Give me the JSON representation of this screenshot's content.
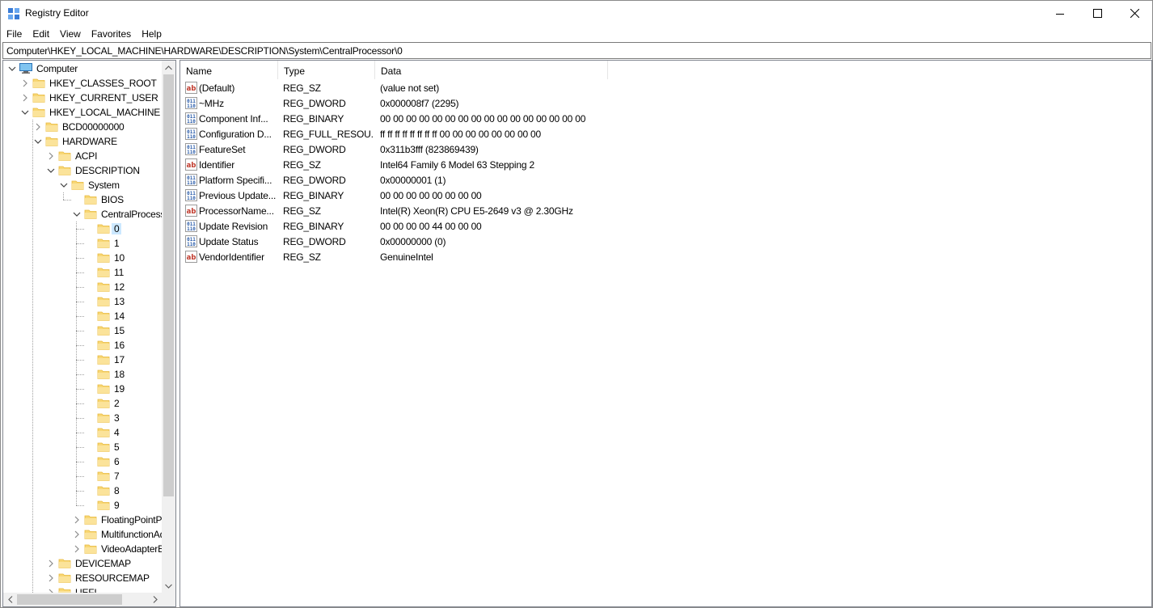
{
  "window": {
    "title": "Registry Editor"
  },
  "menu": [
    "File",
    "Edit",
    "View",
    "Favorites",
    "Help"
  ],
  "address": "Computer\\HKEY_LOCAL_MACHINE\\HARDWARE\\DESCRIPTION\\System\\CentralProcessor\\0",
  "tree": [
    {
      "label": "Computer",
      "level": 0,
      "expander": "expanded",
      "icon": "computer-icon"
    },
    {
      "label": "HKEY_CLASSES_ROOT",
      "level": 1,
      "expander": "collapsed",
      "icon": "folder-icon"
    },
    {
      "label": "HKEY_CURRENT_USER",
      "level": 1,
      "expander": "collapsed",
      "icon": "folder-icon"
    },
    {
      "label": "HKEY_LOCAL_MACHINE",
      "level": 1,
      "expander": "expanded",
      "icon": "folder-icon"
    },
    {
      "label": "BCD00000000",
      "level": 2,
      "expander": "collapsed",
      "icon": "folder-icon"
    },
    {
      "label": "HARDWARE",
      "level": 2,
      "expander": "expanded",
      "icon": "folder-icon"
    },
    {
      "label": "ACPI",
      "level": 3,
      "expander": "collapsed",
      "icon": "folder-icon"
    },
    {
      "label": "DESCRIPTION",
      "level": 3,
      "expander": "expanded",
      "icon": "folder-icon"
    },
    {
      "label": "System",
      "level": 4,
      "expander": "expanded",
      "icon": "folder-icon"
    },
    {
      "label": "BIOS",
      "level": 5,
      "expander": "none",
      "icon": "folder-icon"
    },
    {
      "label": "CentralProcessor",
      "level": 5,
      "expander": "expanded",
      "icon": "folder-icon"
    },
    {
      "label": "0",
      "level": 6,
      "expander": "none",
      "icon": "folder-icon",
      "selected": true
    },
    {
      "label": "1",
      "level": 6,
      "expander": "none",
      "icon": "folder-icon"
    },
    {
      "label": "10",
      "level": 6,
      "expander": "none",
      "icon": "folder-icon"
    },
    {
      "label": "11",
      "level": 6,
      "expander": "none",
      "icon": "folder-icon"
    },
    {
      "label": "12",
      "level": 6,
      "expander": "none",
      "icon": "folder-icon"
    },
    {
      "label": "13",
      "level": 6,
      "expander": "none",
      "icon": "folder-icon"
    },
    {
      "label": "14",
      "level": 6,
      "expander": "none",
      "icon": "folder-icon"
    },
    {
      "label": "15",
      "level": 6,
      "expander": "none",
      "icon": "folder-icon"
    },
    {
      "label": "16",
      "level": 6,
      "expander": "none",
      "icon": "folder-icon"
    },
    {
      "label": "17",
      "level": 6,
      "expander": "none",
      "icon": "folder-icon"
    },
    {
      "label": "18",
      "level": 6,
      "expander": "none",
      "icon": "folder-icon"
    },
    {
      "label": "19",
      "level": 6,
      "expander": "none",
      "icon": "folder-icon"
    },
    {
      "label": "2",
      "level": 6,
      "expander": "none",
      "icon": "folder-icon"
    },
    {
      "label": "3",
      "level": 6,
      "expander": "none",
      "icon": "folder-icon"
    },
    {
      "label": "4",
      "level": 6,
      "expander": "none",
      "icon": "folder-icon"
    },
    {
      "label": "5",
      "level": 6,
      "expander": "none",
      "icon": "folder-icon"
    },
    {
      "label": "6",
      "level": 6,
      "expander": "none",
      "icon": "folder-icon"
    },
    {
      "label": "7",
      "level": 6,
      "expander": "none",
      "icon": "folder-icon"
    },
    {
      "label": "8",
      "level": 6,
      "expander": "none",
      "icon": "folder-icon"
    },
    {
      "label": "9",
      "level": 6,
      "expander": "none",
      "icon": "folder-icon"
    },
    {
      "label": "FloatingPointProcessor",
      "level": 5,
      "expander": "collapsed",
      "icon": "folder-icon"
    },
    {
      "label": "MultifunctionAdapter",
      "level": 5,
      "expander": "collapsed",
      "icon": "folder-icon"
    },
    {
      "label": "VideoAdapterBusses",
      "level": 5,
      "expander": "collapsed",
      "icon": "folder-icon"
    },
    {
      "label": "DEVICEMAP",
      "level": 3,
      "expander": "collapsed",
      "icon": "folder-icon"
    },
    {
      "label": "RESOURCEMAP",
      "level": 3,
      "expander": "collapsed",
      "icon": "folder-icon"
    },
    {
      "label": "UEFI",
      "level": 3,
      "expander": "collapsed",
      "icon": "folder-icon"
    }
  ],
  "columns": [
    "Name",
    "Type",
    "Data"
  ],
  "values": [
    {
      "name": "(Default)",
      "type": "REG_SZ",
      "data": "(value not set)",
      "icon": "string-value-icon"
    },
    {
      "name": "~MHz",
      "type": "REG_DWORD",
      "data": "0x000008f7 (2295)",
      "icon": "binary-value-icon"
    },
    {
      "name": "Component Inf...",
      "type": "REG_BINARY",
      "data": "00 00 00 00 00 00 00 00 00 00 00 00 00 00 00 00",
      "icon": "binary-value-icon"
    },
    {
      "name": "Configuration D...",
      "type": "REG_FULL_RESOU...",
      "data": "ff ff ff ff ff ff ff ff 00 00 00 00 00 00 00 00",
      "icon": "binary-value-icon"
    },
    {
      "name": "FeatureSet",
      "type": "REG_DWORD",
      "data": "0x311b3fff (823869439)",
      "icon": "binary-value-icon"
    },
    {
      "name": "Identifier",
      "type": "REG_SZ",
      "data": "Intel64 Family 6 Model 63 Stepping 2",
      "icon": "string-value-icon"
    },
    {
      "name": "Platform Specifi...",
      "type": "REG_DWORD",
      "data": "0x00000001 (1)",
      "icon": "binary-value-icon"
    },
    {
      "name": "Previous Update...",
      "type": "REG_BINARY",
      "data": "00 00 00 00 00 00 00 00",
      "icon": "binary-value-icon"
    },
    {
      "name": "ProcessorName...",
      "type": "REG_SZ",
      "data": "Intel(R) Xeon(R) CPU E5-2649 v3 @ 2.30GHz",
      "icon": "string-value-icon"
    },
    {
      "name": "Update Revision",
      "type": "REG_BINARY",
      "data": "00 00 00 00 44 00 00 00",
      "icon": "binary-value-icon"
    },
    {
      "name": "Update Status",
      "type": "REG_DWORD",
      "data": "0x00000000 (0)",
      "icon": "binary-value-icon"
    },
    {
      "name": "VendorIdentifier",
      "type": "REG_SZ",
      "data": "GenuineIntel",
      "icon": "string-value-icon"
    }
  ],
  "colors": {
    "selection": "#cce8ff",
    "folder": "#f8d775",
    "folder_dark": "#e8b93c",
    "string_icon": "#c0392b",
    "binary_icon": "#2a5caa"
  }
}
